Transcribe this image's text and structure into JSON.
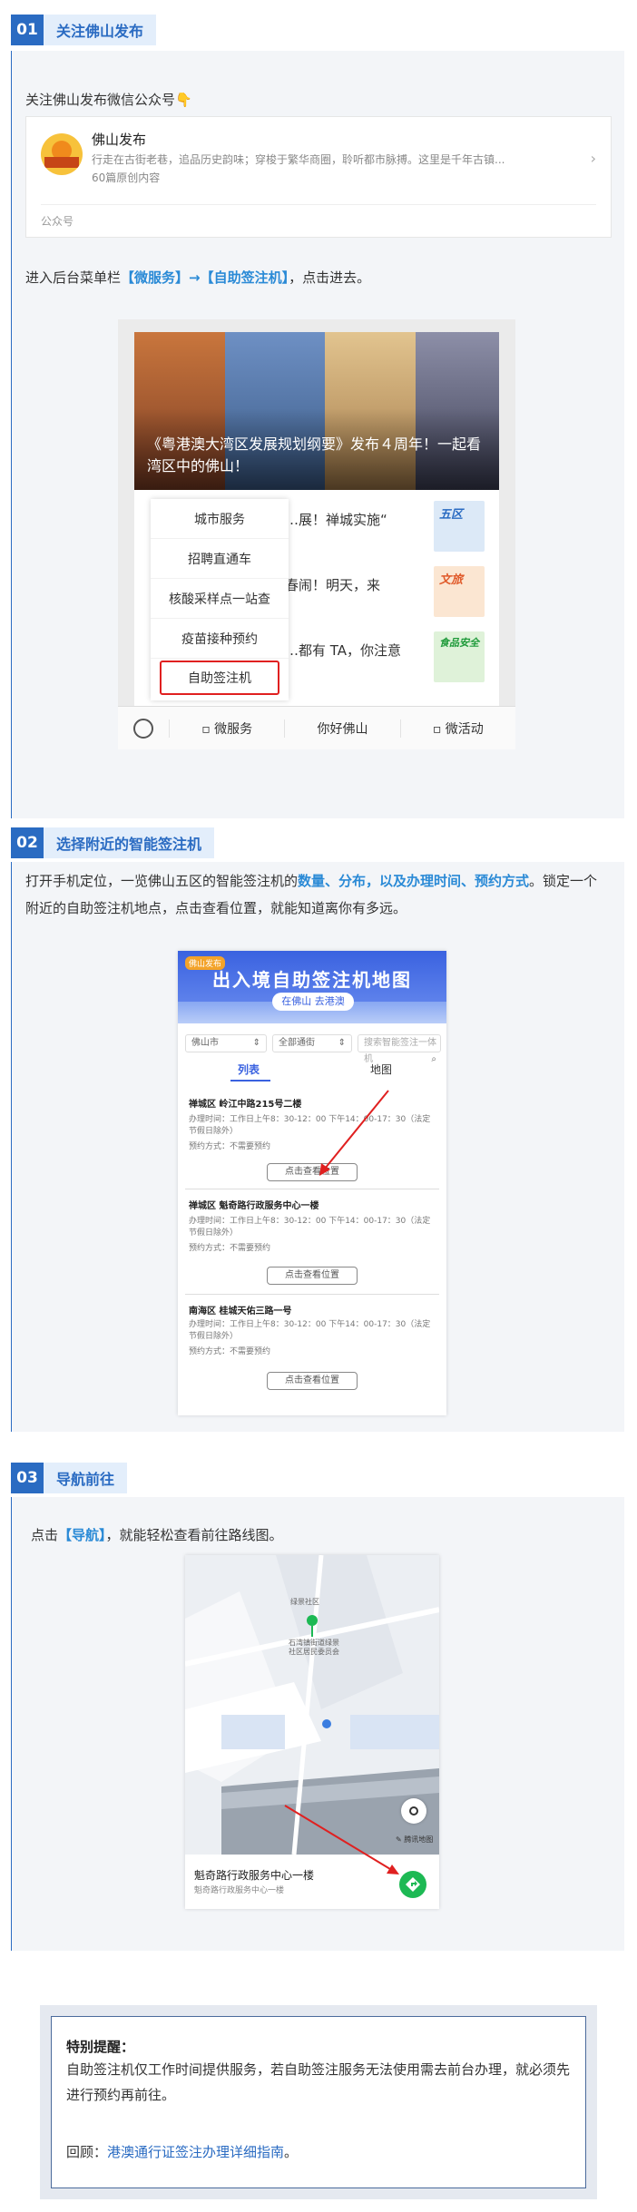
{
  "step1": {
    "num": "01",
    "title": "关注佛山发布",
    "intro": "关注佛山发布微信公众号👇",
    "card": {
      "name": "佛山发布",
      "desc": "行走在古街老巷，追品历史韵味；穿梭于繁华商圈，聆听都市脉搏。这里是千年古镇...",
      "count": "60篇原创内容",
      "footer": "公众号"
    },
    "instruction_pre": "进入后台菜单栏",
    "instruction_blue": "【微服务】→【自助签注机】",
    "instruction_post": "，点击进去。",
    "phone": {
      "banner_title": "《粤港澳大湾区发展规划纲要》发布４周年！一起看湾区中的佛山！",
      "news": [
        "…展！禅城实施“",
        "春闹！明天，来",
        "…都有 TA，你注意"
      ],
      "thumbs": [
        {
          "label": "五区",
          "color": "#2a6bc2"
        },
        {
          "label": "文旅",
          "color": "#e05a2a"
        },
        {
          "label": "食品安全",
          "color": "#1f9a3a"
        }
      ],
      "menu": [
        "城市服务",
        "招聘直通车",
        "核酸采样点一站查",
        "疫苗接种预约",
        "自助签注机"
      ],
      "tabs": [
        "微服务",
        "你好佛山",
        "微活动"
      ]
    }
  },
  "step2": {
    "num": "02",
    "title": "选择附近的智能签注机",
    "text_a": "打开手机定位，一览佛山五区的智能签注机的",
    "text_blue": "数量、分布，以及办理时间、预约方式",
    "text_b": "。锁定一个附近的自助签注机地点，点击查看位置，就能知道离你有多远。",
    "phone": {
      "logo": "佛山发布",
      "title": "出入境自助签注机地图",
      "subtitle": "在佛山 去港澳",
      "filters": [
        "佛山市",
        "全部通街",
        "搜索智能签注一体机"
      ],
      "tabs": [
        "列表",
        "地图"
      ],
      "items": [
        {
          "title": "禅城区 岭江中路215号二楼",
          "hours": "办理时间：工作日上午8：30-12：00 下午14：00-17：30（法定节假日除外）",
          "booking": "预约方式：不需要预约",
          "button": "点击查看位置"
        },
        {
          "title": "禅城区 魁奇路行政服务中心一楼",
          "hours": "办理时间：工作日上午8：30-12：00 下午14：00-17：30（法定节假日除外）",
          "booking": "预约方式：不需要预约",
          "button": "点击查看位置"
        },
        {
          "title": "南海区 桂城天佑三路一号",
          "hours": "办理时间：工作日上午8：30-12：00 下午14：00-17：30（法定节假日除外）",
          "booking": "预约方式：不需要预约",
          "button": "点击查看位置"
        }
      ]
    }
  },
  "step3": {
    "num": "03",
    "title": "导航前往",
    "text_pre": "点击",
    "text_blue": "【导航】",
    "text_post": "，就能轻松查看前往路线图。",
    "map": {
      "poi1": "绿景社区",
      "poi2": "石湾镇街道绿景社区居民委员会",
      "credit": "腾讯地图",
      "place_name": "魁奇路行政服务中心一楼",
      "place_addr": "魁奇路行政服务中心一楼"
    }
  },
  "reminder": {
    "title": "特别提醒：",
    "body": "自助签注机仅工作时间提供服务，若自助签注服务无法使用需去前台办理，就必须先进行预约再前往。",
    "review_label": "回顾：",
    "review_link": "港澳通行证签注办理详细指南",
    "review_end": "。"
  },
  "colors": {
    "accent": "#2a6bc2",
    "link": "#2a8ad6",
    "highlight": "#e02020",
    "nav": "#1db954"
  }
}
